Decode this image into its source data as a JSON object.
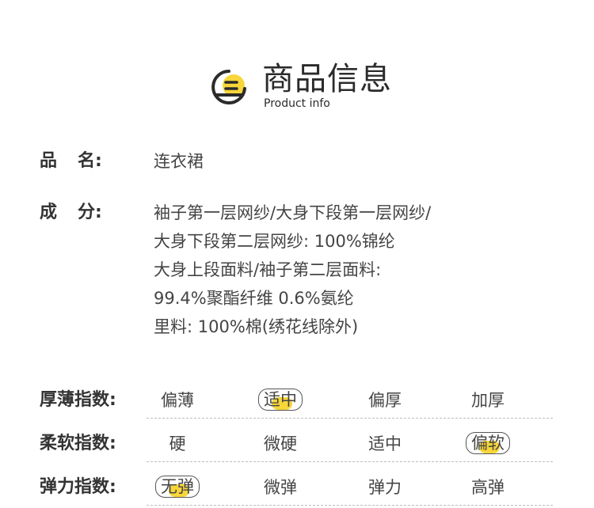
{
  "header": {
    "title": "商品信息",
    "subtitle": "Product info",
    "icon": "document-lines-icon",
    "accent_color": "#f8d63a"
  },
  "fields": [
    {
      "label_first": "品",
      "label_second": "名:",
      "lines": [
        "连衣裙"
      ]
    },
    {
      "label_first": "成",
      "label_second": "分:",
      "lines": [
        "袖子第一层网纱/大身下段第一层网纱/",
        "大身下段第二层网纱: 100%锦纶",
        "大身上段面料/袖子第二层面料:",
        "99.4%聚酯纤维 0.6%氨纶",
        "里料: 100%棉(绣花线除外)"
      ]
    }
  ],
  "indices": [
    {
      "label": "厚薄指数:",
      "options": [
        "偏薄",
        "适中",
        "偏厚",
        "加厚"
      ],
      "selected": "适中"
    },
    {
      "label": "柔软指数:",
      "options": [
        "硬",
        "微硬",
        "适中",
        "偏软"
      ],
      "selected": "偏软"
    },
    {
      "label": "弹力指数:",
      "options": [
        "无弹",
        "微弹",
        "弹力",
        "高弹"
      ],
      "selected": "无弹"
    }
  ]
}
